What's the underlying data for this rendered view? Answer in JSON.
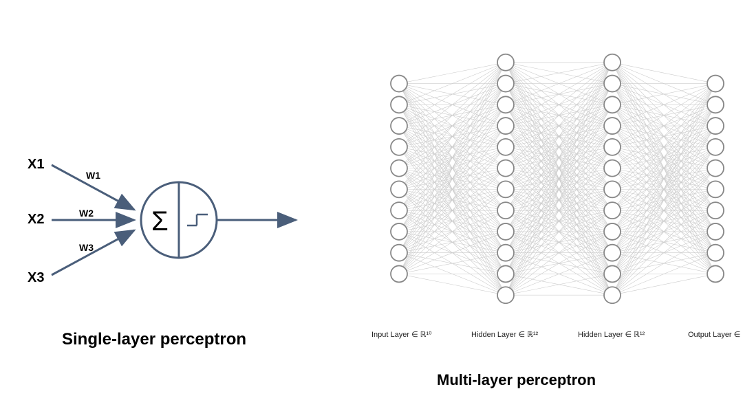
{
  "slp": {
    "title": "Single-layer perceptron",
    "inputs": [
      "X1",
      "X2",
      "X3"
    ],
    "weights": [
      "W1",
      "W2",
      "W3"
    ],
    "sum_symbol": "Σ",
    "activation": "step"
  },
  "mlp": {
    "title": "Multi-layer perceptron",
    "layers": [
      {
        "label": "Input Layer ∈ ℝ¹⁰",
        "nodes": 10
      },
      {
        "label": "Hidden Layer ∈ ℝ¹²",
        "nodes": 12
      },
      {
        "label": "Hidden Layer ∈ ℝ¹²",
        "nodes": 12
      },
      {
        "label": "Output Layer ∈",
        "nodes": 10
      }
    ]
  },
  "colors": {
    "slp_stroke": "#4a5e7a",
    "mlp_node_stroke": "#888888",
    "mlp_edge": "#cccccc"
  }
}
